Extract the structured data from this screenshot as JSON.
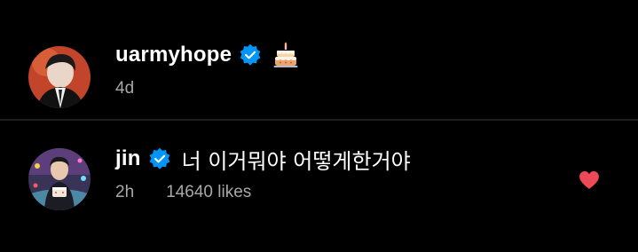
{
  "comments": [
    {
      "username": "uarmyhope",
      "verified": true,
      "emoji_icon": "birthday-cake-icon",
      "text": "",
      "time": "4d",
      "likes": ""
    },
    {
      "username": "jin",
      "verified": true,
      "text": "너 이거뭐야 어떻게한거야",
      "time": "2h",
      "likes": "14640 likes",
      "liked": true
    }
  ],
  "colors": {
    "background": "#000000",
    "text": "#ffffff",
    "meta": "#a8a8a8",
    "verified": "#0095f6",
    "heart": "#ed4956",
    "divider": "#1e1e1e"
  }
}
